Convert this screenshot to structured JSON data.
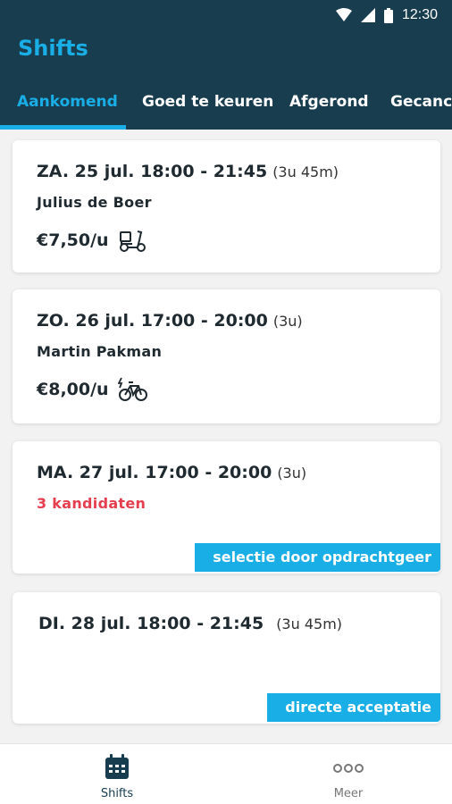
{
  "status": {
    "time": "12:30"
  },
  "header": {
    "title": "Shifts"
  },
  "tabs": [
    {
      "label": "Aankomend"
    },
    {
      "label": "Goed te keuren"
    },
    {
      "label": "Afgerond"
    },
    {
      "label": "Gecance"
    }
  ],
  "shifts": [
    {
      "date_time": "ZA. 25 jul. 18:00 - 21:45",
      "duration": "(3u 45m)",
      "name": "Julius de Boer",
      "rate": "€7,50/u",
      "vehicle_icon": "scooter-icon"
    },
    {
      "date_time": "ZO. 26 jul. 17:00 - 20:00",
      "duration": "(3u)",
      "name": "Martin Pakman",
      "rate": "€8,00/u",
      "vehicle_icon": "e-bike-icon"
    },
    {
      "date_time": "MA. 27 jul. 17:00 - 20:00",
      "duration": "(3u)",
      "candidates": "3 kandidaten",
      "badge": "selectie door opdrachtgeer"
    },
    {
      "date_time": "DI. 28 jul. 18:00 - 21:45",
      "duration": "(3u 45m)",
      "badge": "directe acceptatie"
    }
  ],
  "bottom_nav": [
    {
      "label": "Shifts",
      "icon": "calendar-icon"
    },
    {
      "label": "Meer",
      "icon": "more-icon"
    }
  ],
  "colors": {
    "primary_dark": "#183d4f",
    "accent": "#19aee6",
    "alert": "#e53f4f"
  }
}
